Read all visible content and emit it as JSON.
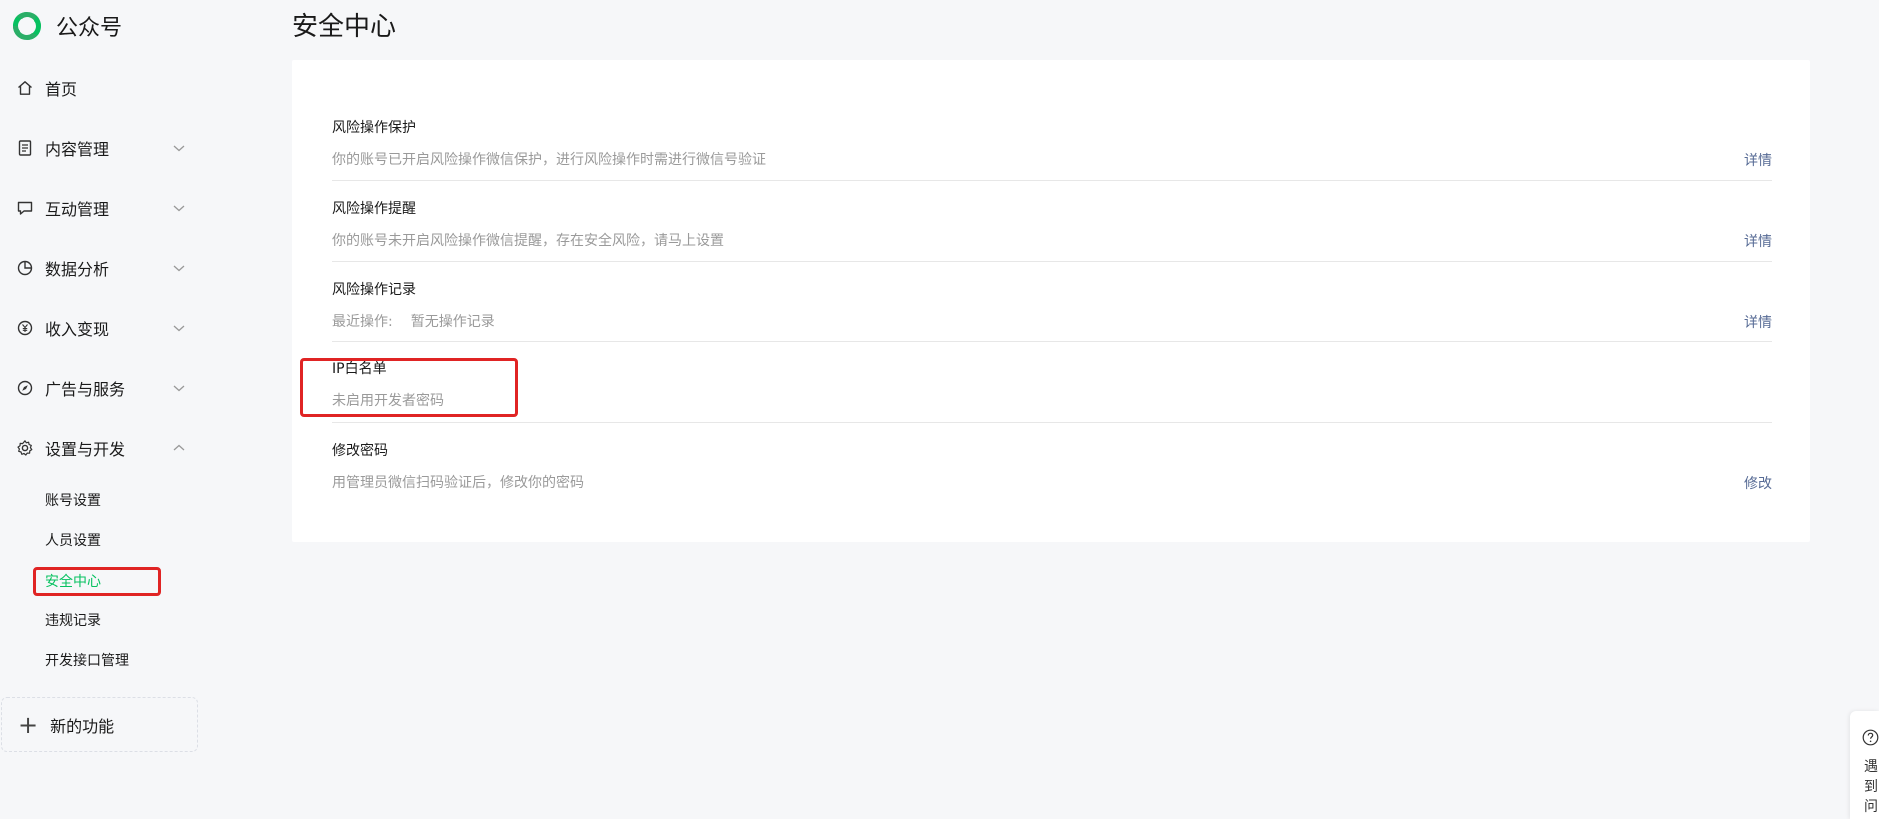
{
  "brand": {
    "name": "公众号"
  },
  "nav": {
    "home": "首页",
    "content": "内容管理",
    "interaction": "互动管理",
    "analytics": "数据分析",
    "income": "收入变现",
    "ads": "广告与服务",
    "settings": "设置与开发"
  },
  "submenu": {
    "account": "账号设置",
    "members": "人员设置",
    "security": "安全中心",
    "violations": "违规记录",
    "dev_api": "开发接口管理"
  },
  "new_feature": "新的功能",
  "page": {
    "title": "安全中心"
  },
  "security": [
    {
      "title": "风险操作保护",
      "desc": "你的账号已开启风险操作微信保护，进行风险操作时需进行微信号验证",
      "action": "详情"
    },
    {
      "title": "风险操作提醒",
      "desc": "你的账号未开启风险操作微信提醒，存在安全风险，请马上设置",
      "action": "详情"
    },
    {
      "title": "风险操作记录",
      "desc_label": "最近操作:",
      "desc_value": "暂无操作记录",
      "action": "详情"
    },
    {
      "title": "IP白名单",
      "desc": "未启用开发者密码"
    },
    {
      "title": "修改密码",
      "desc": "用管理员微信扫码验证后，修改你的密码",
      "action": "修改"
    }
  ],
  "help": {
    "text": "遇到问"
  },
  "colors": {
    "accent": "#07c160",
    "link": "#576b95",
    "highlight": "#e02424"
  },
  "icons": [
    "wechat-mp-logo",
    "home-icon",
    "document-icon",
    "chat-icon",
    "pie-chart-icon",
    "yen-icon",
    "compass-icon",
    "gear-icon",
    "chevron-down-icon",
    "chevron-up-icon",
    "plus-icon",
    "help-icon"
  ]
}
